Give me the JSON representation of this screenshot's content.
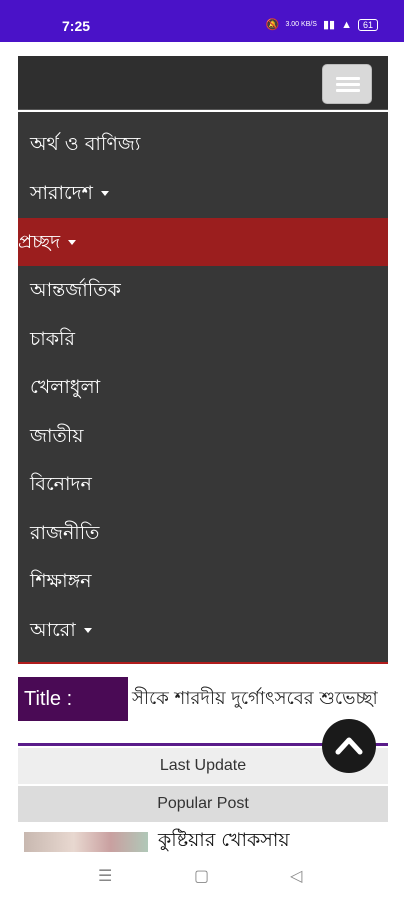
{
  "status_bar": {
    "time": "7:25",
    "network": "3.00 KB/S",
    "battery": "61"
  },
  "menu": {
    "items": [
      {
        "label": "অর্থ ও বাণিজ্য",
        "dropdown": false,
        "active": false
      },
      {
        "label": "সারাদেশ",
        "dropdown": true,
        "active": false
      },
      {
        "label": "প্রচ্ছদ",
        "dropdown": true,
        "active": true
      },
      {
        "label": "আন্তর্জাতিক",
        "dropdown": false,
        "active": false
      },
      {
        "label": "চাকরি",
        "dropdown": false,
        "active": false
      },
      {
        "label": "খেলাধুলা",
        "dropdown": false,
        "active": false
      },
      {
        "label": "জাতীয়",
        "dropdown": false,
        "active": false
      },
      {
        "label": "বিনোদন",
        "dropdown": false,
        "active": false
      },
      {
        "label": "রাজনীতি",
        "dropdown": false,
        "active": false
      },
      {
        "label": "শিক্ষাঙ্গন",
        "dropdown": false,
        "active": false
      },
      {
        "label": "আরো",
        "dropdown": true,
        "active": false
      }
    ]
  },
  "ticker": {
    "label": "Title :",
    "text": "সীকে শারদীয় দুর্গোৎসবের শুভেচ্ছা"
  },
  "tabs": {
    "last_update": "Last Update",
    "popular_post": "Popular Post"
  },
  "post": {
    "title": "কুষ্টিয়ার খোকসায়"
  },
  "colors": {
    "status_bar": "#4a12c8",
    "menu_bg": "#373737",
    "active_item": "#9b1e1e",
    "ticker_label": "#4a0a55"
  }
}
